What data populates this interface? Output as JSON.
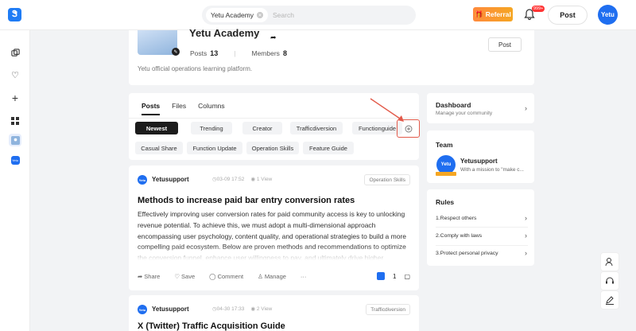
{
  "header": {
    "search_chip": "Yetu Academy",
    "search_placeholder": "Search",
    "referral_label": "Referral",
    "notification_count": "999+",
    "post_label": "Post",
    "avatar_text": "Yetu"
  },
  "sidebar": {
    "items": [
      "layers-icon",
      "heart-icon",
      "plus-icon",
      "grid-icon",
      "community-icon",
      "yetu-icon"
    ],
    "yetu_text": "Yetu"
  },
  "group": {
    "title": "Yetu Academy",
    "posts_label": "Posts",
    "posts_count": "13",
    "members_label": "Members",
    "members_count": "8",
    "post_button": "Post",
    "description": "Yetu official operations learning platform."
  },
  "tabs": [
    "Posts",
    "Files",
    "Columns"
  ],
  "filters": {
    "row1": [
      "Newest",
      "Trending",
      "Creator",
      "Trafficdiversion",
      "Functionguide"
    ],
    "row2": [
      "Casual Share",
      "Function Update",
      "Operation Skills",
      "Feature Guide"
    ]
  },
  "posts": [
    {
      "author": "Yetusupport",
      "avatar_text": "Yetu",
      "date": "03-09 17:52",
      "views": "1 View",
      "tag": "Operation Skills",
      "title": "Methods to increase paid bar entry conversion rates",
      "body": "Effectively improving user conversion rates for paid community access is key to unlocking revenue potential. To achieve this, we must adopt a multi-dimensional approach encompassing user psychology, content quality, and operational strategies to build a more compelling paid ecosystem. Below are proven methods and recommendations to optimize the conversion funnel, enhance user willingness to pay, and ultimately drive higher",
      "actions": [
        "Share",
        "Save",
        "Comment",
        "Manage",
        "···"
      ],
      "likes": "1"
    },
    {
      "author": "Yetusupport",
      "avatar_text": "Yetu",
      "date": "04-30 17:33",
      "views": "2 View",
      "tag": "Trafficdiversion",
      "title": "X (Twitter) Traffic Acquisition Guide"
    }
  ],
  "dashboard": {
    "title": "Dashboard",
    "subtitle": "Manage your community"
  },
  "team": {
    "heading": "Team",
    "name": "Yetusupport",
    "desc": "With a mission to \"make c...",
    "avatar_text": "Yetu"
  },
  "rules": {
    "heading": "Rules",
    "items": [
      "1.Respect others",
      "2.Comply with laws",
      "3.Protect personal privacy"
    ]
  },
  "colors": {
    "brand": "#1f6ef0",
    "referral": "#f5a623",
    "highlight": "#e25a4a"
  }
}
